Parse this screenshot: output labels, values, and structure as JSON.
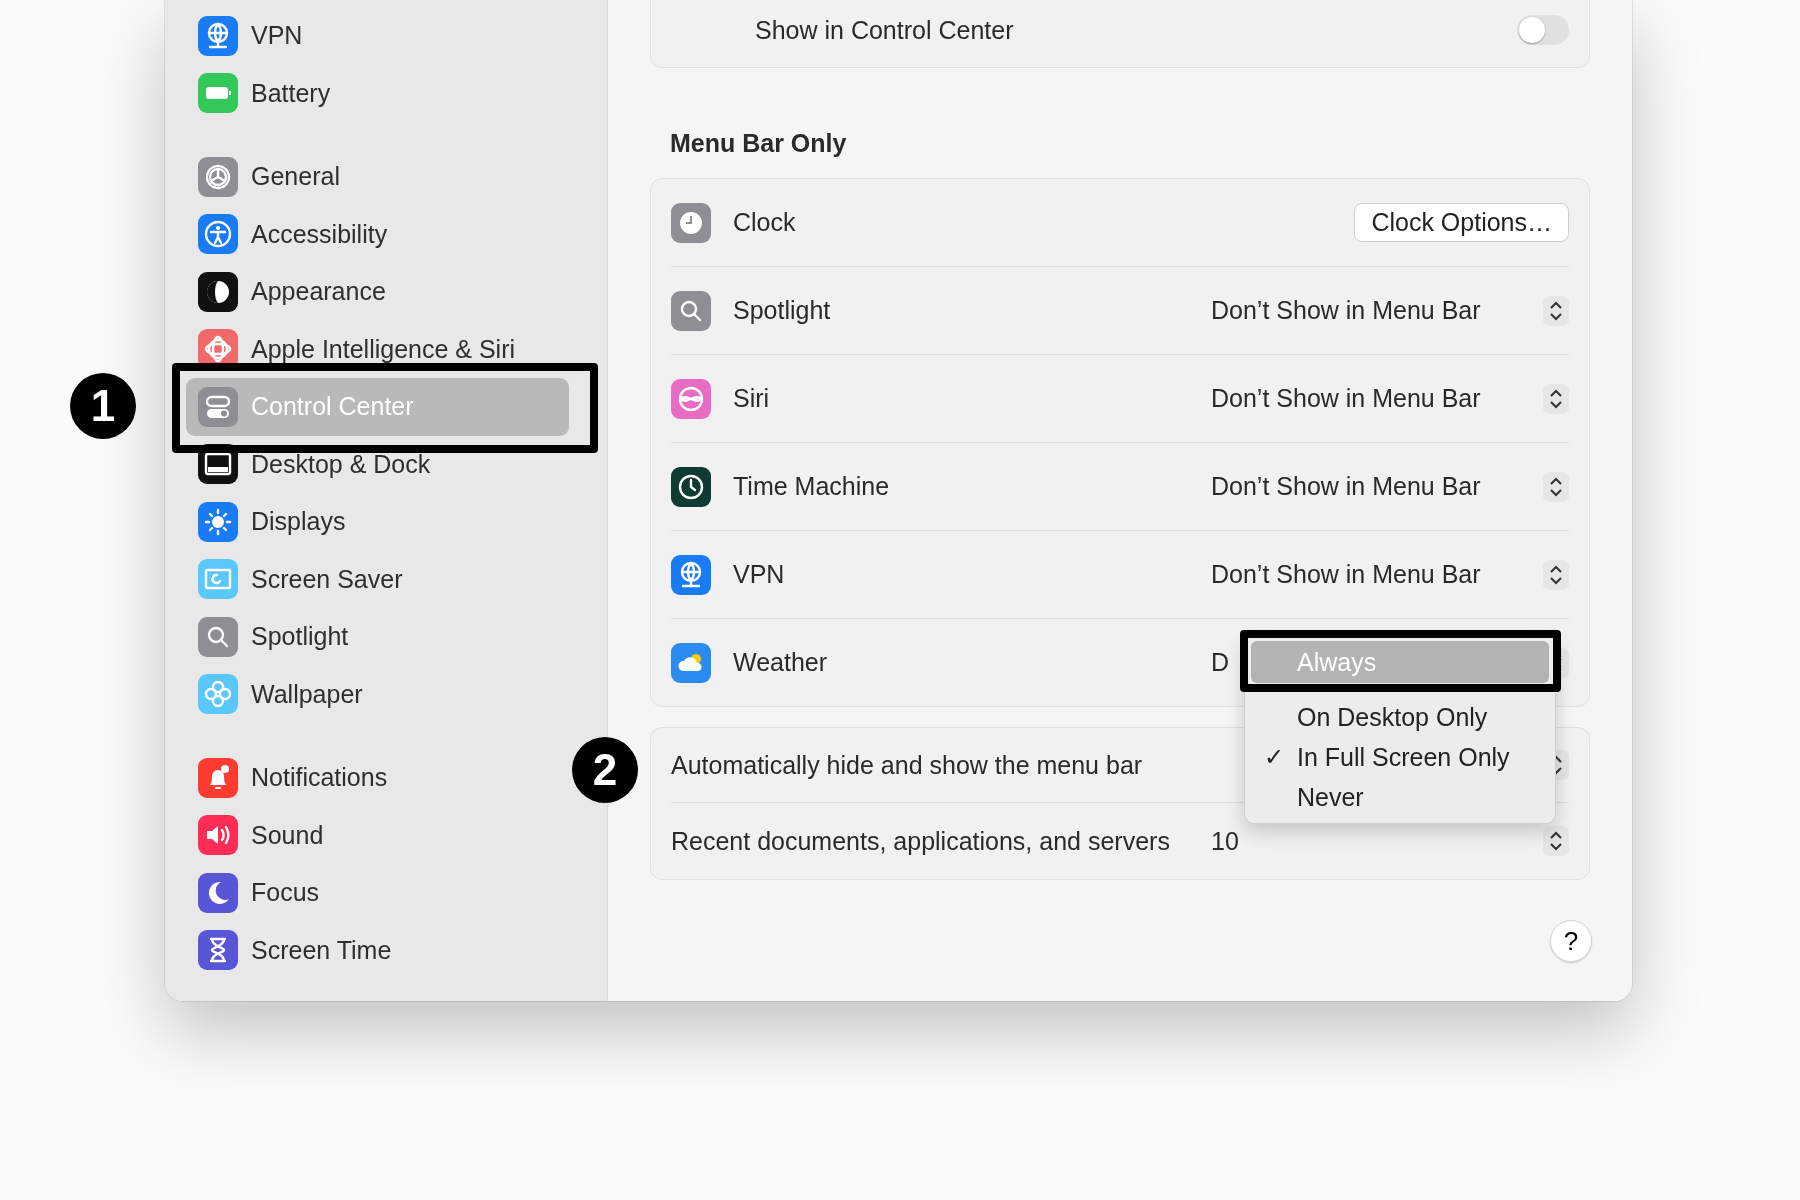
{
  "sidebar": {
    "groups": [
      {
        "items": [
          {
            "label": "VPN",
            "selected": false
          },
          {
            "label": "Battery",
            "selected": false
          }
        ]
      },
      {
        "items": [
          {
            "label": "General",
            "selected": false
          },
          {
            "label": "Accessibility",
            "selected": false
          },
          {
            "label": "Appearance",
            "selected": false
          },
          {
            "label": "Apple Intelligence & Siri",
            "selected": false
          },
          {
            "label": "Control Center",
            "selected": true
          },
          {
            "label": "Desktop & Dock",
            "selected": false
          },
          {
            "label": "Displays",
            "selected": false
          },
          {
            "label": "Screen Saver",
            "selected": false
          },
          {
            "label": "Spotlight",
            "selected": false
          },
          {
            "label": "Wallpaper",
            "selected": false
          }
        ]
      },
      {
        "items": [
          {
            "label": "Notifications",
            "selected": false
          },
          {
            "label": "Sound",
            "selected": false
          },
          {
            "label": "Focus",
            "selected": false
          },
          {
            "label": "Screen Time",
            "selected": false
          }
        ]
      }
    ]
  },
  "top_card": {
    "label": "Show in Control Center",
    "on": false
  },
  "section": {
    "title": "Menu Bar Only",
    "rows": [
      {
        "kind": "button",
        "label": "Clock",
        "button": "Clock Options…"
      },
      {
        "kind": "popup",
        "label": "Spotlight",
        "value": "Don’t Show in Menu Bar"
      },
      {
        "kind": "popup",
        "label": "Siri",
        "value": "Don’t Show in Menu Bar"
      },
      {
        "kind": "popup",
        "label": "Time Machine",
        "value": "Don’t Show in Menu Bar"
      },
      {
        "kind": "popup",
        "label": "VPN",
        "value": "Don’t Show in Menu Bar"
      },
      {
        "kind": "popup",
        "label": "Weather",
        "value": "D"
      }
    ]
  },
  "options": [
    {
      "label": "Automatically hide and show the menu bar"
    },
    {
      "label": "Recent documents, applications, and servers",
      "value": "10"
    }
  ],
  "help": "?",
  "menu": [
    {
      "label": "Always",
      "selected": true,
      "checked": false
    },
    {
      "label": "On Desktop Only",
      "selected": false,
      "checked": false
    },
    {
      "label": "In Full Screen Only",
      "selected": false,
      "checked": true
    },
    {
      "label": "Never",
      "selected": false,
      "checked": false
    }
  ],
  "check_mark": "✓",
  "callouts": [
    {
      "number": "1"
    },
    {
      "number": "2"
    }
  ]
}
